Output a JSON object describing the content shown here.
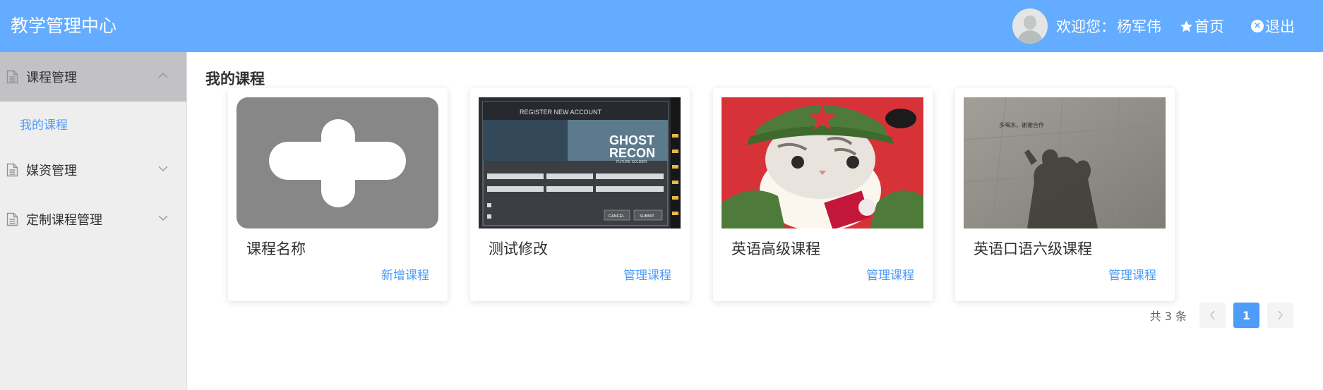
{
  "header": {
    "app_title": "教学管理中心",
    "welcome_label": "欢迎您：",
    "user_name": "杨军伟",
    "home_label": "首页",
    "logout_label": "退出"
  },
  "sidebar": {
    "groups": [
      {
        "label": "课程管理",
        "expanded": true,
        "sub_items": [
          {
            "label": "我的课程"
          }
        ]
      },
      {
        "label": "媒资管理",
        "expanded": false
      },
      {
        "label": "定制课程管理",
        "expanded": false
      }
    ]
  },
  "main": {
    "section_title": "我的课程",
    "cards": [
      {
        "title": "课程名称",
        "action": "新增课程",
        "thumbnail": "plus-icon"
      },
      {
        "title": "测试修改",
        "action": "管理课程",
        "thumbnail": "game-register-screenshot",
        "image_text": {
          "dialog_title": "REGISTER NEW ACCOUNT",
          "logo_line1": "GHOST",
          "logo_line2": "RECON",
          "logo_sub": "FUTURE SOLDIER",
          "cancel": "CANCEL",
          "submit": "SUBMIT"
        }
      },
      {
        "title": "英语高级课程",
        "action": "管理课程",
        "thumbnail": "cat-cartoon-illustration"
      },
      {
        "title": "英语口语六级课程",
        "action": "管理课程",
        "thumbnail": "shadow-photo",
        "image_text": {
          "caption": "多喝水，谢谢合作"
        }
      }
    ],
    "pagination": {
      "total_text": "共 3 条",
      "current_page": "1"
    }
  },
  "colors": {
    "header_bg": "#64acff",
    "accent": "#4d9cf8",
    "sidebar_bg": "#eeeeef",
    "sidebar_active_bg": "#c2c1c6"
  }
}
